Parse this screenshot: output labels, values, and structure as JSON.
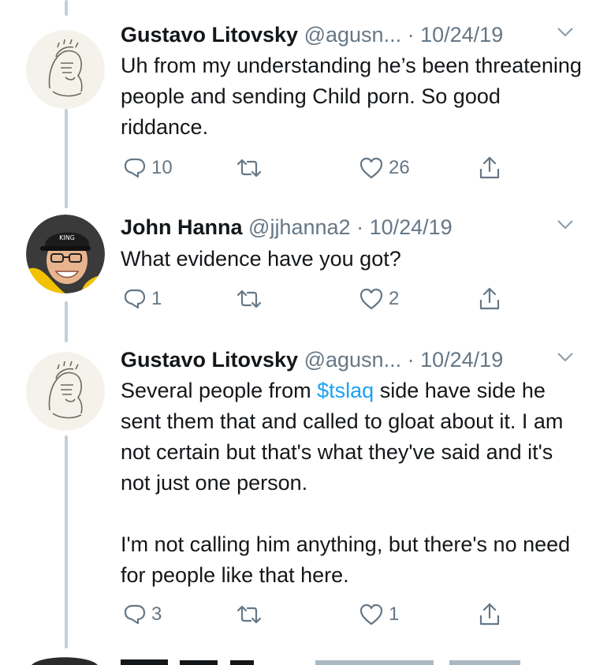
{
  "tweets": [
    {
      "name": "Gustavo Litovsky",
      "handle": "@agusn...",
      "dot": "·",
      "date": "10/24/19",
      "body": [
        "Uh from my understanding he’s been threatening people and sending Child porn. So good riddance."
      ],
      "replies": "10",
      "retweets": "",
      "likes": "26"
    },
    {
      "name": "John Hanna",
      "handle": "@jjhanna2",
      "dot": "·",
      "date": "10/24/19",
      "body": [
        "What evidence have you got?"
      ],
      "replies": "1",
      "retweets": "",
      "likes": "2"
    },
    {
      "name": "Gustavo Litovsky",
      "handle": "@agusn...",
      "dot": "·",
      "date": "10/24/19",
      "body_before_cashtag": "Several people from ",
      "cashtag": "$tslaq",
      "body_after_cashtag": " side have side he sent them that and called to gloat about it. I am not certain but that's what they've said and it's not just one person.",
      "body_para2": "I'm not calling him anything, but there's no need for people like that here.",
      "replies": "3",
      "retweets": "",
      "likes": "1"
    }
  ],
  "icons": {
    "reply": "reply-icon",
    "retweet": "retweet-icon",
    "like": "heart-icon",
    "share": "share-icon",
    "caret": "chevron-down-icon"
  },
  "colors": {
    "text": "#14171a",
    "secondary": "#657786",
    "link": "#1da1f2",
    "thread_line": "#c4cfd6"
  }
}
